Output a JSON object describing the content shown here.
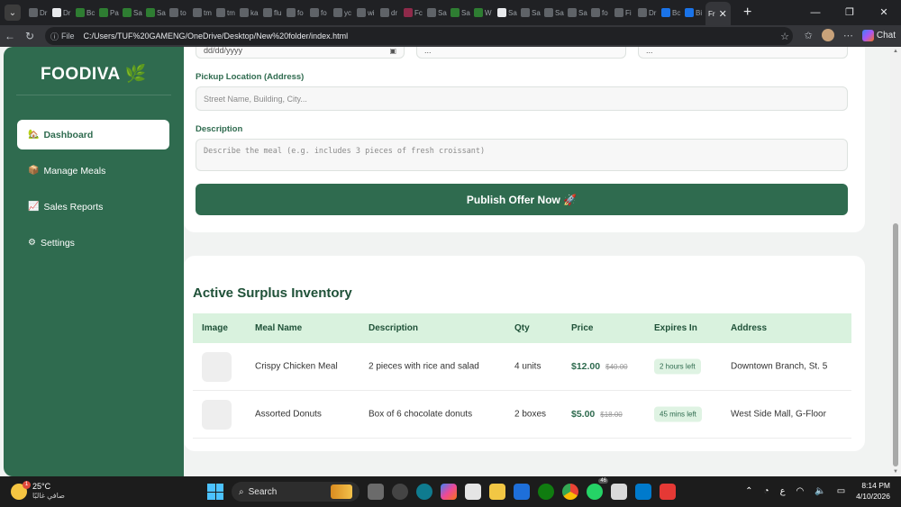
{
  "browser": {
    "tabs": [
      {
        "label": "Dr",
        "color": "#5f6368"
      },
      {
        "label": "Dr",
        "color": "#e8eaed"
      },
      {
        "label": "Bc",
        "color": "#2e7d32"
      },
      {
        "label": "Pa",
        "color": "#2e7d32"
      },
      {
        "label": "Sa",
        "color": "#2e7d32"
      },
      {
        "label": "Sa",
        "color": "#2e7d32"
      },
      {
        "label": "to",
        "color": "#5f6368"
      },
      {
        "label": "tm",
        "color": "#5f6368"
      },
      {
        "label": "tm",
        "color": "#5f6368"
      },
      {
        "label": "ka",
        "color": "#5f6368"
      },
      {
        "label": "flu",
        "color": "#5f6368"
      },
      {
        "label": "fo",
        "color": "#5f6368"
      },
      {
        "label": "fo",
        "color": "#5f6368"
      },
      {
        "label": "yc",
        "color": "#5f6368"
      },
      {
        "label": "wi",
        "color": "#5f6368"
      },
      {
        "label": "dr",
        "color": "#5f6368"
      },
      {
        "label": "Fc",
        "color": "#8e2a4a"
      },
      {
        "label": "Sa",
        "color": "#5f6368"
      },
      {
        "label": "Sa",
        "color": "#2e7d32"
      },
      {
        "label": "W",
        "color": "#2e7d32"
      },
      {
        "label": "Sa",
        "color": "#e8eaed"
      },
      {
        "label": "Sa",
        "color": "#5f6368"
      },
      {
        "label": "Sa",
        "color": "#5f6368"
      },
      {
        "label": "Sa",
        "color": "#5f6368"
      },
      {
        "label": "fo",
        "color": "#5f6368"
      },
      {
        "label": "Fi",
        "color": "#5f6368"
      },
      {
        "label": "Dr",
        "color": "#5f6368"
      },
      {
        "label": "Bc",
        "color": "#1a73e8"
      },
      {
        "label": "Bi",
        "color": "#1a73e8"
      }
    ],
    "active_tab": "Fr",
    "url_scheme_label": "File",
    "url": "C:/Users/TUF%20GAMENG/OneDrive/Desktop/New%20folder/index.html",
    "chat_label": "Chat"
  },
  "app": {
    "brand": "FOODIVA 🌿",
    "nav": [
      {
        "icon": "🏡",
        "label": "Dashboard",
        "active": true
      },
      {
        "icon": "📦",
        "label": "Manage Meals",
        "active": false
      },
      {
        "icon": "📈",
        "label": "Sales Reports",
        "active": false
      },
      {
        "icon": "⚙",
        "label": "Settings",
        "active": false
      }
    ],
    "form": {
      "date_value": "dd/dd/yyyy",
      "price_value": "...",
      "qty_value": "...",
      "pickup_label": "Pickup Location (Address)",
      "pickup_placeholder": "Street Name, Building, City...",
      "description_label": "Description",
      "description_placeholder": "Describe the meal (e.g. includes 3 pieces of fresh croissant)",
      "publish_label": "Publish Offer Now 🚀"
    },
    "inventory": {
      "title": "Active Surplus Inventory",
      "columns": [
        "Image",
        "Meal Name",
        "Description",
        "Qty",
        "Price",
        "Expires In",
        "Address"
      ],
      "rows": [
        {
          "name": "Crispy Chicken Meal",
          "description": "2 pieces with rice and salad",
          "qty": "4 units",
          "price": "$12.00",
          "old_price": "$40.00",
          "expires": "2 hours left",
          "address": "Downtown Branch, St. 5"
        },
        {
          "name": "Assorted Donuts",
          "description": "Box of 6 chocolate donuts",
          "qty": "2 boxes",
          "price": "$5.00",
          "old_price": "$18.00",
          "expires": "45 mins left",
          "address": "West Side Mall, G-Floor"
        }
      ]
    }
  },
  "taskbar": {
    "temperature": "25°C",
    "weather_text": "صافي غالبًا",
    "weather_badge": "1",
    "search_label": "Search",
    "whatsapp_count": "46",
    "lang": "ع",
    "time": "8:14 PM",
    "date": "4/10/2026"
  }
}
